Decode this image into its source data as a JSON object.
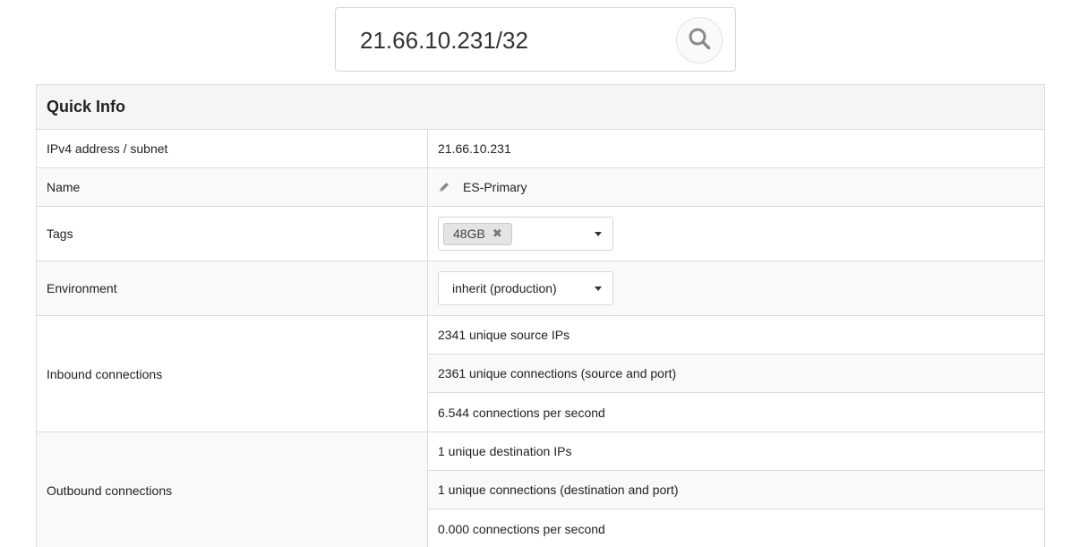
{
  "search": {
    "value": "21.66.10.231/32",
    "icon": "search-icon"
  },
  "quick_info": {
    "title": "Quick Info",
    "rows": {
      "ip": {
        "label": "IPv4 address / subnet",
        "value": "21.66.10.231"
      },
      "name": {
        "label": "Name",
        "value": "ES-Primary",
        "icon": "pencil-icon"
      },
      "tags": {
        "label": "Tags",
        "selected": [
          "48GB"
        ],
        "remove_symbol": "✖"
      },
      "environment": {
        "label": "Environment",
        "value": "inherit (production)"
      },
      "inbound": {
        "label": "Inbound connections",
        "items": [
          "2341 unique source IPs",
          "2361 unique connections (source and port)",
          "6.544 connections per second"
        ]
      },
      "outbound": {
        "label": "Outbound connections",
        "items": [
          "1 unique destination IPs",
          "1 unique connections (destination and port)",
          "0.000 connections per second"
        ]
      }
    }
  }
}
